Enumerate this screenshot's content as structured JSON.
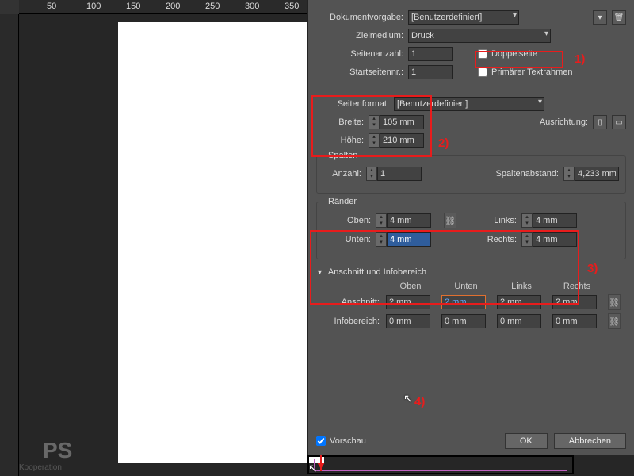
{
  "ruler": [
    "50",
    "100",
    "150",
    "200",
    "250",
    "300",
    "350"
  ],
  "doc": {
    "preset_lbl": "Dokumentvorgabe:",
    "preset": "[Benutzerdefiniert]",
    "intent_lbl": "Zielmedium:",
    "intent": "Druck",
    "pages_lbl": "Seitenanzahl:",
    "pages": "1",
    "facing_lbl": "Doppelseite",
    "start_lbl": "Startseitennr.:",
    "start": "1",
    "frame_lbl": "Primärer Textrahmen"
  },
  "pg": {
    "size_lbl": "Seitenformat:",
    "size": "[Benutzerdefiniert]",
    "w_lbl": "Breite:",
    "w": "105 mm",
    "h_lbl": "Höhe:",
    "h": "210 mm",
    "orient_lbl": "Ausrichtung:"
  },
  "col": {
    "title": "Spalten",
    "n_lbl": "Anzahl:",
    "n": "1",
    "g_lbl": "Spaltenabstand:",
    "g": "4,233 mm"
  },
  "mar": {
    "title": "Ränder",
    "t_lbl": "Oben:",
    "t": "4 mm",
    "b_lbl": "Unten:",
    "b": "4 mm",
    "l_lbl": "Links:",
    "l": "4 mm",
    "r_lbl": "Rechts:",
    "r": "4 mm"
  },
  "bs": {
    "title": "Anschnitt und Infobereich",
    "t": "Oben",
    "b": "Unten",
    "l": "Links",
    "r": "Rechts",
    "bleed_lbl": "Anschnitt:",
    "bleed": [
      "2 mm",
      "2 mm",
      "2 mm",
      "2 mm"
    ],
    "slug_lbl": "Infobereich:",
    "slug": [
      "0 mm",
      "0 mm",
      "0 mm",
      "0 mm"
    ]
  },
  "foot": {
    "preview": "Vorschau",
    "ok": "OK",
    "cancel": "Abbrechen"
  },
  "anno": {
    "a1": "1)",
    "a2": "2)",
    "a3": "3)",
    "a4": "4)"
  },
  "logo": {
    "p": "PS",
    "k": "Kooperation"
  }
}
